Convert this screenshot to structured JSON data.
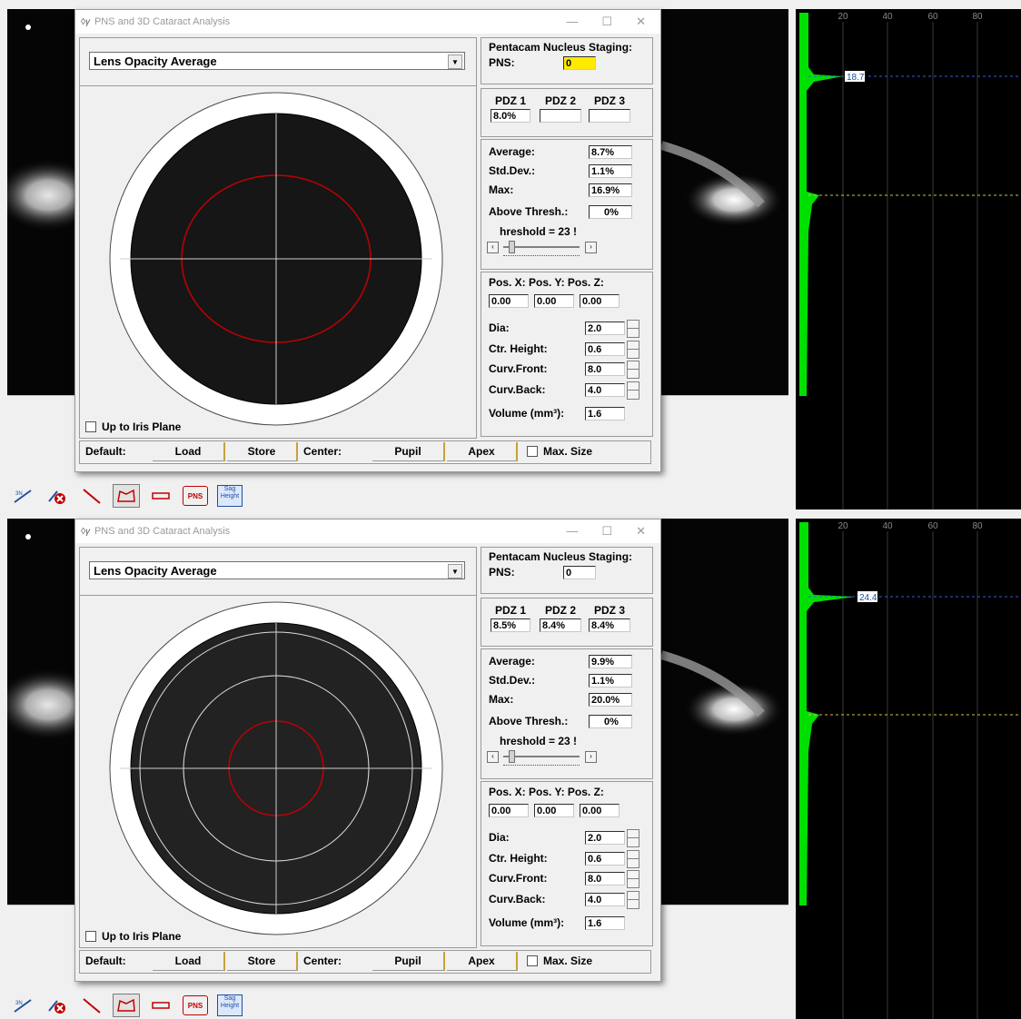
{
  "panels": [
    {
      "graph_label": "18.7",
      "dialog": {
        "title": "PNS and 3D Cataract Analysis",
        "dropdown": "Lens Opacity Average",
        "staging_title": "Pentacam Nucleus Staging:",
        "pns_label": "PNS:",
        "pns_value": "0",
        "pdz_headers": [
          "PDZ 1",
          "PDZ 2",
          "PDZ 3"
        ],
        "pdz_values": [
          "8.0%",
          "",
          ""
        ],
        "average_label": "Average:",
        "average": "8.7%",
        "stddev_label": "Std.Dev.:",
        "stddev": "1.1%",
        "max_label": "Max:",
        "max": "16.9%",
        "above_label": "Above Thresh.:",
        "above": "0%",
        "threshold": "hreshold = 23 !",
        "pos_headers": "Pos. X: Pos. Y: Pos. Z:",
        "pos_values": [
          "0.00",
          "0.00",
          "0.00"
        ],
        "dia_label": "Dia:",
        "dia": "2.0",
        "ctr_label": "Ctr. Height:",
        "ctr": "0.6",
        "front_label": "Curv.Front:",
        "front": "8.0",
        "back_label": "Curv.Back:",
        "back": "4.0",
        "volume_label": "Volume (mm³):",
        "volume": "1.6",
        "iris_label": "Up to Iris Plane",
        "default_label": "Default:",
        "load": "Load",
        "store": "Store",
        "center_label": "Center:",
        "pupil": "Pupil",
        "apex": "Apex",
        "max_size": "Max. Size"
      }
    },
    {
      "graph_label": "24.4",
      "dialog": {
        "title": "PNS and 3D Cataract Analysis",
        "dropdown": "Lens Opacity Average",
        "staging_title": "Pentacam Nucleus Staging:",
        "pns_label": "PNS:",
        "pns_value": "0",
        "pdz_headers": [
          "PDZ 1",
          "PDZ 2",
          "PDZ 3"
        ],
        "pdz_values": [
          "8.5%",
          "8.4%",
          "8.4%"
        ],
        "average_label": "Average:",
        "average": "9.9%",
        "stddev_label": "Std.Dev.:",
        "stddev": "1.1%",
        "max_label": "Max:",
        "max": "20.0%",
        "above_label": "Above Thresh.:",
        "above": "0%",
        "threshold": "hreshold = 23 !",
        "pos_headers": "Pos. X: Pos. Y: Pos. Z:",
        "pos_values": [
          "0.00",
          "0.00",
          "0.00"
        ],
        "dia_label": "Dia:",
        "dia": "2.0",
        "ctr_label": "Ctr. Height:",
        "ctr": "0.6",
        "front_label": "Curv.Front:",
        "front": "8.0",
        "back_label": "Curv.Back:",
        "back": "4.0",
        "volume_label": "Volume (mm³):",
        "volume": "1.6",
        "iris_label": "Up to Iris Plane",
        "default_label": "Default:",
        "load": "Load",
        "store": "Store",
        "center_label": "Center:",
        "pupil": "Pupil",
        "apex": "Apex",
        "max_size": "Max. Size"
      }
    }
  ],
  "graph_axis_ticks": [
    "20",
    "40",
    "60",
    "80"
  ],
  "toolbar": {
    "pns": "PNS",
    "sag_line1": "Sag",
    "sag_line2": "Height"
  },
  "colors": {
    "density_fill": "#00e000",
    "highlight": "#ffea00",
    "ring": "#c00000"
  }
}
